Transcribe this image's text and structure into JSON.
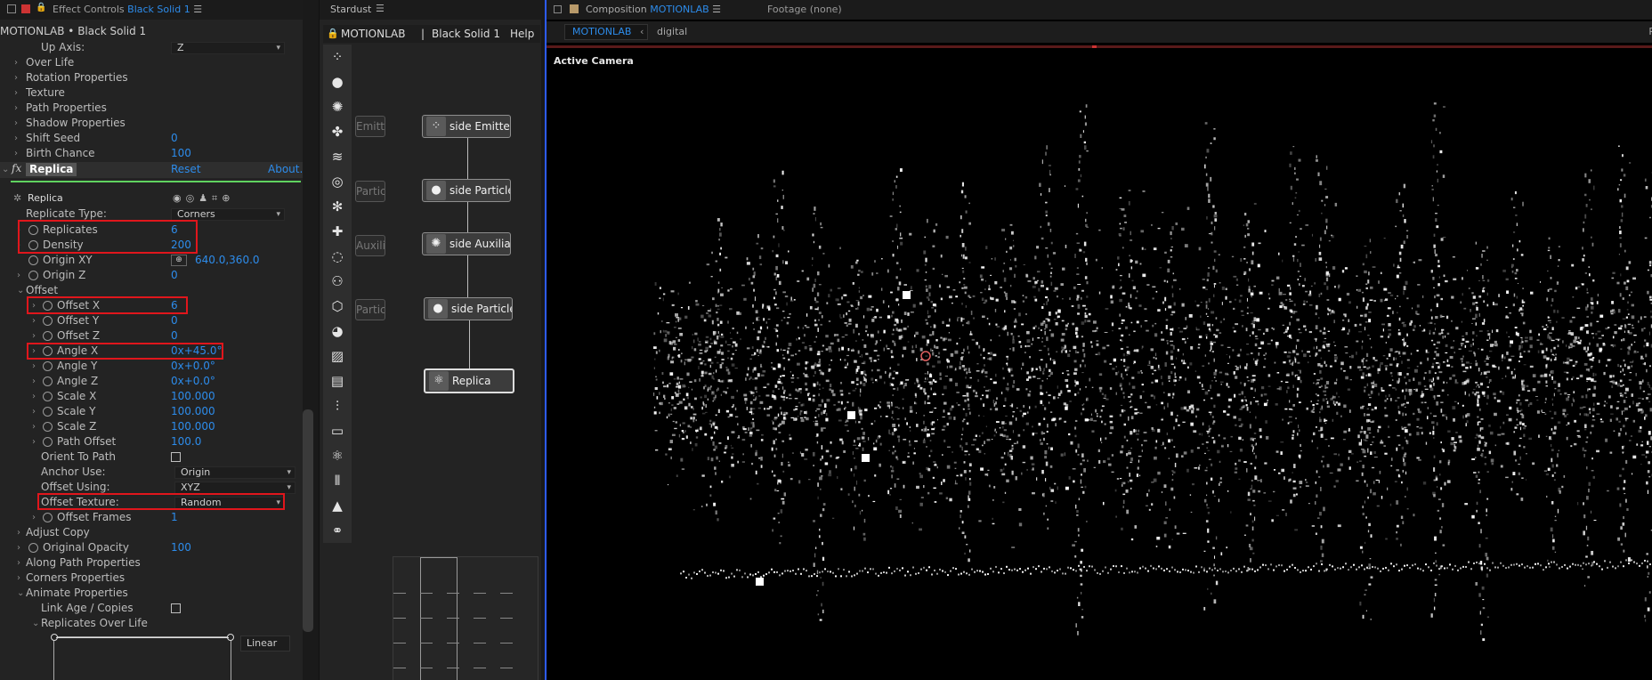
{
  "effect_controls": {
    "tab_label": "Effect Controls",
    "tab_layer": "Black Solid 1",
    "subtitle": "MOTIONLAB • Black Solid 1",
    "rows": {
      "up_axis": {
        "label": "Up Axis:",
        "value": "Z"
      },
      "over_life": "Over Life",
      "rotation": "Rotation Properties",
      "texture": "Texture",
      "path_props": "Path Properties",
      "shadow": "Shadow Properties",
      "shift_seed": {
        "label": "Shift Seed",
        "value": "0"
      },
      "birth_chance": {
        "label": "Birth Chance",
        "value": "100"
      },
      "replicate_type": {
        "label": "Replicate Type:",
        "value": "Corners"
      },
      "replicates": {
        "label": "Replicates",
        "value": "6"
      },
      "density": {
        "label": "Density",
        "value": "200"
      },
      "origin_xy": {
        "label": "Origin XY",
        "value": "640.0,360.0"
      },
      "origin_z": {
        "label": "Origin Z",
        "value": "0"
      },
      "offset": "Offset",
      "offset_x": {
        "label": "Offset X",
        "value": "6"
      },
      "offset_y": {
        "label": "Offset Y",
        "value": "0"
      },
      "offset_z": {
        "label": "Offset Z",
        "value": "0"
      },
      "angle_x": {
        "label": "Angle X",
        "value": "0x+45.0°"
      },
      "angle_y": {
        "label": "Angle Y",
        "value": "0x+0.0°"
      },
      "angle_z": {
        "label": "Angle Z",
        "value": "0x+0.0°"
      },
      "scale_x": {
        "label": "Scale X",
        "value": "100.000"
      },
      "scale_y": {
        "label": "Scale Y",
        "value": "100.000"
      },
      "scale_z": {
        "label": "Scale Z",
        "value": "100.000"
      },
      "path_offset": {
        "label": "Path Offset",
        "value": "100.0"
      },
      "orient_to_path": "Orient To Path",
      "anchor_use": {
        "label": "Anchor Use:",
        "value": "Origin"
      },
      "offset_using": {
        "label": "Offset Using:",
        "value": "XYZ"
      },
      "offset_texture": {
        "label": "Offset Texture:",
        "value": "Random"
      },
      "offset_frames": {
        "label": "Offset Frames",
        "value": "1"
      },
      "adjust_copy": "Adjust Copy",
      "original_opacity": {
        "label": "Original Opacity",
        "value": "100"
      },
      "along_path": "Along Path Properties",
      "corners": "Corners Properties",
      "animate": "Animate Properties",
      "link_age": "Link Age / Copies",
      "replicates_over_life": "Replicates Over Life",
      "interp": "Linear"
    },
    "fx": {
      "name": "Replica",
      "reset": "Reset",
      "about": "About...",
      "group": "Replica"
    }
  },
  "stardust": {
    "tab_label": "Stardust",
    "header": {
      "comp": "MOTIONLAB",
      "sep": "|",
      "layer": "Black Solid 1",
      "help": "Help"
    },
    "nodes": [
      {
        "label": "side Emitter",
        "icon": "emitter-icon"
      },
      {
        "label": "side Particle",
        "icon": "particle-icon"
      },
      {
        "label": "side Auxiliary",
        "icon": "auxiliary-icon"
      },
      {
        "label": "side Particle",
        "icon": "particle-icon"
      },
      {
        "label": "Replica",
        "icon": "replica-icon"
      }
    ],
    "ghost_nodes": [
      "Emitte",
      "Partic",
      "Auxilia",
      "Particle"
    ]
  },
  "composition": {
    "tab_prefix": "Composition",
    "tab_name": "MOTIONLAB",
    "footage": "Footage (none)",
    "subtabs": [
      "MOTIONLAB",
      "digital"
    ],
    "viewer_label": "Active Camera",
    "edge_letter": "R"
  },
  "colors": {
    "accent_blue": "#2d8ceb",
    "highlight_red": "#e0161c",
    "fx_green": "#5fd35f"
  }
}
